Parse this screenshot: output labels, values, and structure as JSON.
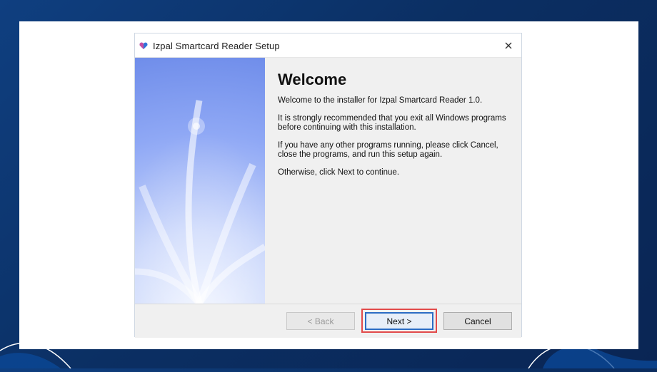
{
  "window": {
    "title": "Izpal Smartcard Reader Setup"
  },
  "welcome": {
    "heading": "Welcome",
    "paragraphs": [
      "Welcome to the installer for Izpal Smartcard Reader 1.0.",
      "It is strongly recommended that you exit all Windows programs before continuing with this installation.",
      "If you have any other programs running, please click Cancel, close the programs, and run this setup again.",
      "Otherwise, click Next to continue."
    ]
  },
  "buttons": {
    "back_label": "< Back",
    "next_label": "Next >",
    "cancel_label": "Cancel"
  },
  "icons": {
    "app_icon": "heart-icon",
    "close_icon": "close-icon"
  },
  "colors": {
    "background_navy": "#0b2f63",
    "highlight_red": "#e24a4a",
    "focus_blue": "#2b6cc4"
  }
}
